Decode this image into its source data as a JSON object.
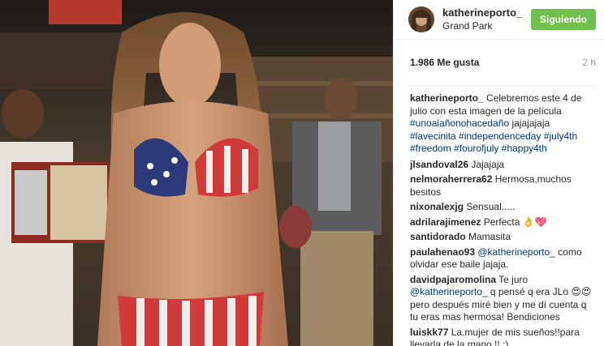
{
  "post": {
    "username": "katherineporto_",
    "location": "Grand Park",
    "follow_label": "Siguiendo",
    "likes": "1.986 Me gusta",
    "age": "2 h"
  },
  "caption": {
    "user": "katherineporto_",
    "text": "Celebremos este 4 de julio con esta imagen de la película",
    "tags": [
      "#unoalañonohacedaño",
      "jajajajaja",
      "#lavecinita",
      "#independenceday",
      "#july4th",
      "#freedom",
      "#fourofjuly",
      "#happy4th"
    ]
  },
  "comments": [
    {
      "user": "jlsandoval26",
      "text": "Jajajaja"
    },
    {
      "user": "nelmoraherrera62",
      "text": "Hermosa,muchos besitos"
    },
    {
      "user": "nixonalexjg",
      "text": "Sensual....."
    },
    {
      "user": "adrilarajimenez",
      "text": "Perfecta 👌💖"
    },
    {
      "user": "santidorado",
      "text": "Mamasita"
    },
    {
      "user": "paulahenao93",
      "mention": "@katherineporto_",
      "text": "como olvidar ese baile jajaja."
    },
    {
      "user": "davidpajaromolina",
      "text_pre": "Te juro",
      "mention": "@katherineporto_",
      "text": "q pensé q era JLo 😍😍 pero después miré bien y me dí cuenta q tu eras mas hermosa! Bendiciones"
    },
    {
      "user": "luiskk77",
      "text": "La.mujer de mis sueños!!para llevarla de la mano !! :)"
    }
  ],
  "colors": {
    "follow_bg": "#70c050",
    "hashtag": "#003569",
    "muted": "#999999"
  }
}
